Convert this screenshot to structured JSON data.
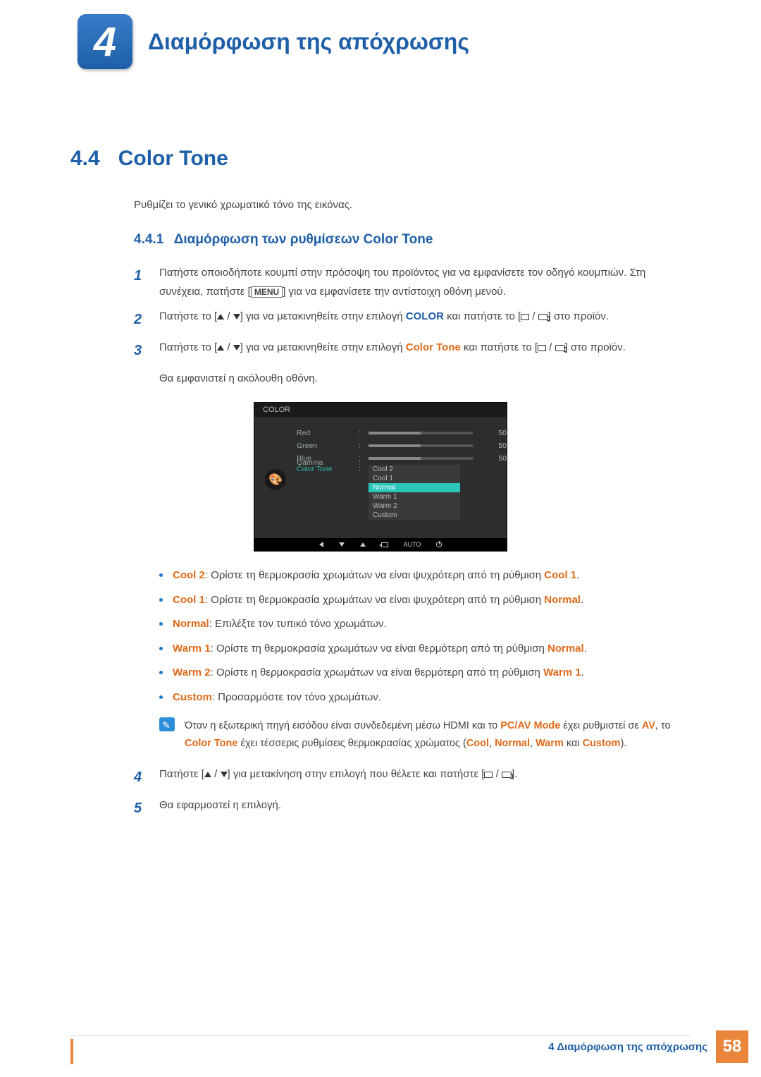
{
  "header": {
    "chapter_num": "4",
    "chapter_title": "Διαμόρφωση της απόχρωσης"
  },
  "section": {
    "num": "4.4",
    "title": "Color Tone",
    "intro": "Ρυθμίζει το γενικό χρωματικό τόνο της εικόνας."
  },
  "subsection": {
    "num": "4.4.1",
    "title": "Διαμόρφωση των ρυθμίσεων Color Tone"
  },
  "steps": {
    "s1": {
      "num": "1",
      "text_a": "Πατήστε οποιοδήποτε κουμπί στην πρόσοψη του προϊόντος για να εμφανίσετε τον οδηγό κουμπιών. Στη συνέχεια, πατήστε [",
      "menu": "MENU",
      "text_b": "] για να εμφανίσετε την αντίστοιχη οθόνη μενού."
    },
    "s2": {
      "num": "2",
      "text_a": "Πατήστε το [",
      "text_b": "] για να μετακινηθείτε στην επιλογή ",
      "kw": "COLOR",
      "text_c": " και πατήστε το [",
      "text_d": "] στο προϊόν."
    },
    "s3": {
      "num": "3",
      "text_a": "Πατήστε το [",
      "text_b": "] για να μετακινηθείτε στην επιλογή ",
      "kw": "Color Tone",
      "text_c": " και πατήστε το [",
      "text_d": "] στο προϊόν.",
      "after": "Θα εμφανιστεί η ακόλουθη οθόνη."
    },
    "s4": {
      "num": "4",
      "text_a": "Πατήστε [",
      "text_b": "] για μετακίνηση στην επιλογή που θέλετε και πατήστε [",
      "text_c": "]."
    },
    "s5": {
      "num": "5",
      "text": "Θα εφαρμοστεί η επιλογή."
    }
  },
  "osd": {
    "title": "COLOR",
    "rows": {
      "red": {
        "label": "Red",
        "val": "50"
      },
      "green": {
        "label": "Green",
        "val": "50"
      },
      "blue": {
        "label": "Blue",
        "val": "50"
      },
      "ct": {
        "label": "Color Tone"
      },
      "gamma": {
        "label": "Gamma"
      }
    },
    "options": [
      "Cool 2",
      "Cool 1",
      "Normal",
      "Warm 1",
      "Warm 2",
      "Custom"
    ],
    "auto": "AUTO"
  },
  "bullets": {
    "b1": {
      "kw": "Cool 2",
      "text": ": Ορίστε τη θερμοκρασία χρωμάτων να είναι ψυχρότερη από τη ρύθμιση ",
      "ref": "Cool 1",
      "end": "."
    },
    "b2": {
      "kw": "Cool 1",
      "text": ": Ορίστε τη θερμοκρασία χρωμάτων να είναι ψυχρότερη από τη ρύθμιση ",
      "ref": "Normal",
      "end": "."
    },
    "b3": {
      "kw": "Normal",
      "text": ": Επιλέξτε τον τυπικό τόνο χρωμάτων."
    },
    "b4": {
      "kw": "Warm 1",
      "text": ": Ορίστε τη θερμοκρασία χρωμάτων να είναι θερμότερη από τη ρύθμιση ",
      "ref": "Normal",
      "end": "."
    },
    "b5": {
      "kw": "Warm 2",
      "text": ": Ορίστε η θερμοκρασία χρωμάτων να είναι θερμότερη από τη ρύθμιση ",
      "ref": "Warm 1",
      "end": "."
    },
    "b6": {
      "kw": "Custom",
      "text": ": Προσαρμόστε τον τόνο χρωμάτων."
    }
  },
  "note": {
    "t1": "Όταν η εξωτερική πηγή εισόδου είναι συνδεδεμένη μέσω HDMI και το ",
    "k1": "PC/AV Mode",
    "t2": " έχει ρυθμιστεί σε ",
    "k2": "AV",
    "t3": ", το ",
    "k3": "Color Tone",
    "t4": " έχει τέσσερις ρυθμίσεις θερμοκρασίας χρώματος (",
    "k4": "Cool",
    "t5": ", ",
    "k5": "Normal",
    "t6": ", ",
    "k6": "Warm",
    "t7": " και ",
    "k7": "Custom",
    "t8": ")."
  },
  "footer": {
    "text": "4 Διαμόρφωση της απόχρωσης",
    "page": "58"
  }
}
